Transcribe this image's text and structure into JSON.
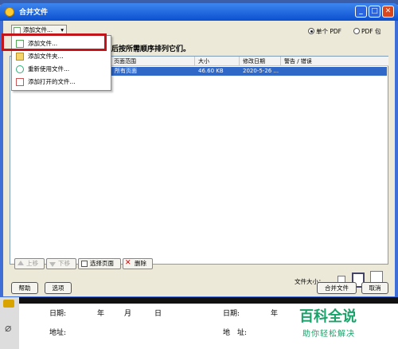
{
  "window": {
    "title": "合并文件"
  },
  "titlebar_buttons": {
    "minimize": "_",
    "maximize": "□",
    "close": "✕"
  },
  "toolbar": {
    "add_file_label": "添加文件..."
  },
  "add_menu": {
    "items": [
      {
        "label": "添加文件...",
        "icon": "file-add-icon"
      },
      {
        "label": "添加文件夹...",
        "icon": "folder-add-icon"
      },
      {
        "label": "重新使用文件...",
        "icon": "reuse-file-icon"
      },
      {
        "label": "添加打开的文件...",
        "icon": "open-file-add-icon"
      }
    ]
  },
  "output_mode": {
    "single_pdf": "单个 PDF",
    "pdf_package": "PDF 包",
    "selected": "single_pdf"
  },
  "instruction": "后按所需顺序排列它们。",
  "file_table": {
    "columns": [
      "页面范围",
      "大小",
      "修改日期",
      "警告 / 错误"
    ],
    "rows": [
      {
        "page_range": "所有页面",
        "size": "46.60 KB",
        "modified": "2020-5-26 ...",
        "warning": ""
      }
    ]
  },
  "list_actions": {
    "move_up": "上移",
    "move_down": "下移",
    "choose_pages": "选择页面",
    "remove": "删除"
  },
  "file_size": {
    "label": "文件大小："
  },
  "footer": {
    "help": "帮助",
    "options": "选项",
    "merge": "合并文件",
    "cancel": "取消"
  },
  "document": {
    "date_label": "日期:",
    "year": "年",
    "month": "月",
    "day": "日",
    "address_label": "地址:",
    "date_label_2": "日期:",
    "year_2": "年",
    "address_label_2": "地　址:"
  },
  "watermark": {
    "brand": "百科全说",
    "slogan": "助你轻松解决"
  },
  "colors": {
    "title_blue": "#0b4fcf",
    "selection_blue": "#3068c8",
    "highlight_red": "#c3141a",
    "watermark_green": "#1aa26a"
  }
}
